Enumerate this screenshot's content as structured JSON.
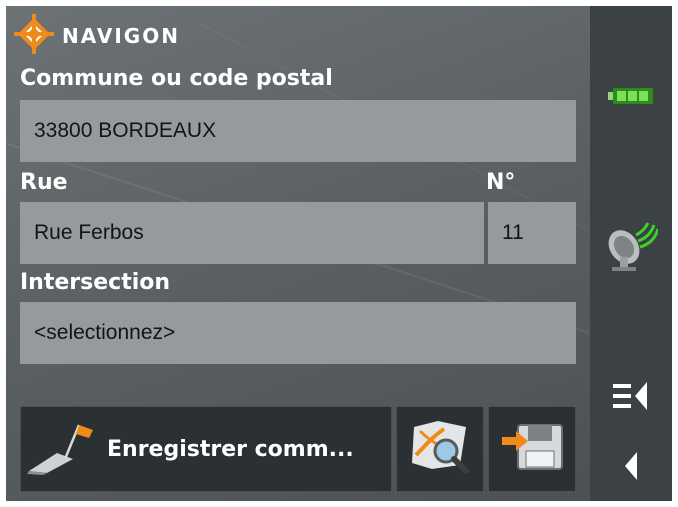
{
  "brand": {
    "name": "NAVIGON",
    "icon": "navigon-diamond-logo"
  },
  "form": {
    "city": {
      "label": "Commune ou code postal",
      "value": "33800 BORDEAUX"
    },
    "street": {
      "label": "Rue",
      "value": "Rue Ferbos"
    },
    "number": {
      "label": "N°",
      "value": "11"
    },
    "intersection": {
      "label": "Intersection",
      "value": "<selectionnez>"
    }
  },
  "actions": {
    "save": {
      "label": "Enregistrer comm...",
      "icon": "flag-destination-icon"
    },
    "search_map": {
      "icon": "map-search-icon"
    },
    "save_to_disk": {
      "icon": "save-disk-icon"
    }
  },
  "side": {
    "battery": "battery-full-icon",
    "gps": "gps-satellite-icon",
    "menu": "menu-icon",
    "back": "back-icon"
  },
  "colors": {
    "accent_orange": "#f08a1a",
    "battery_green": "#55c832",
    "gps_green": "#3fd12b"
  }
}
